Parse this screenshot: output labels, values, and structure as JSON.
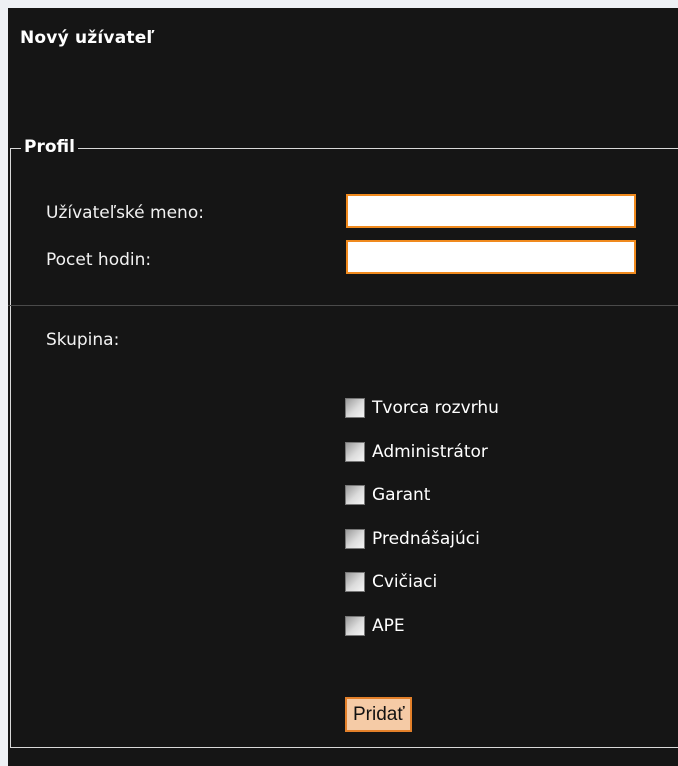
{
  "page": {
    "title": "Nový užívateľ"
  },
  "profile": {
    "legend": "Profil",
    "username_label": "Užívateľské meno:",
    "username_value": "",
    "hours_label": "Pocet hodin:",
    "hours_value": "",
    "group_label": "Skupina:"
  },
  "groups": [
    {
      "label": "Tvorca rozvrhu",
      "checked": false
    },
    {
      "label": "Administrátor",
      "checked": false
    },
    {
      "label": "Garant",
      "checked": false
    },
    {
      "label": "Prednášajúci",
      "checked": false
    },
    {
      "label": "Cvičiaci",
      "checked": false
    },
    {
      "label": "APE",
      "checked": false
    }
  ],
  "actions": {
    "submit_label": "Pridať"
  },
  "colors": {
    "background": "#151515",
    "input_border": "#f08a1e",
    "button_fill": "#f5cba6"
  }
}
